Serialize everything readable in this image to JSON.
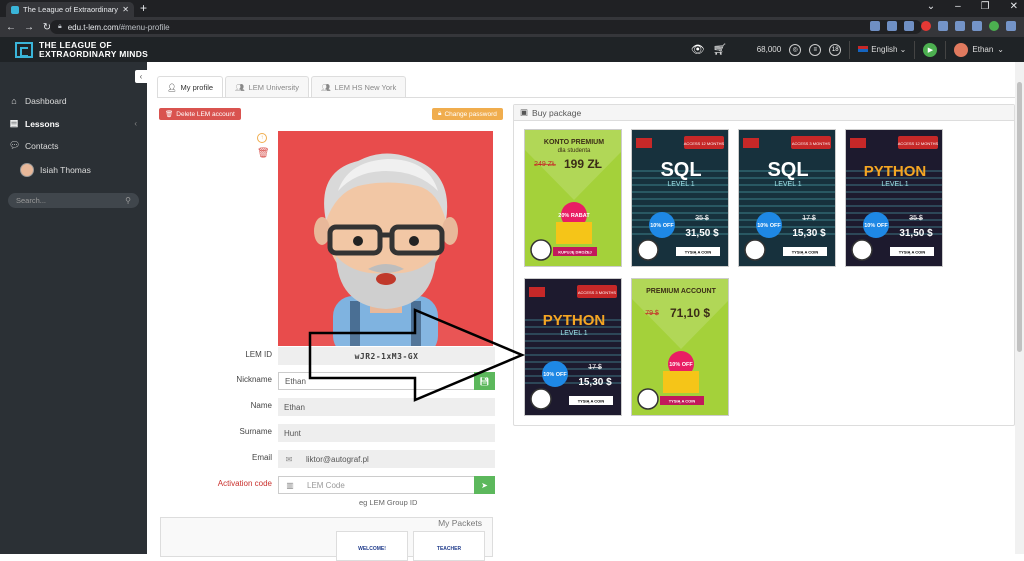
{
  "browser": {
    "tab_title": "The League of Extraordinary Mi",
    "url_host": "edu.t-lem.com",
    "url_path": "/#menu-profile"
  },
  "app": {
    "logo_line1": "THE LEAGUE OF",
    "logo_line2": "EXTRAORDINARY MINDS",
    "coins": "68,000",
    "badge3": "18",
    "language": "English",
    "user_name": "Ethan"
  },
  "sidebar": {
    "items": [
      {
        "label": "Dashboard"
      },
      {
        "label": "Lessons"
      },
      {
        "label": "Contacts"
      },
      {
        "label": "Isiah Thomas"
      }
    ],
    "search_placeholder": "Search..."
  },
  "tabs": [
    {
      "label": "My profile"
    },
    {
      "label": "LEM University"
    },
    {
      "label": "LEM HS New York"
    }
  ],
  "actions": {
    "delete_label": "Delete LEM account",
    "change_password_label": "Change password"
  },
  "profile": {
    "lem_id_label": "LEM ID",
    "lem_id_value": "wJR2-1xM3-GX",
    "nickname_label": "Nickname",
    "nickname_value": "Ethan",
    "name_label": "Name",
    "name_value": "Ethan",
    "surname_label": "Surname",
    "surname_value": "Hunt",
    "email_label": "Email",
    "email_value": "liktor@autograf.pl",
    "activation_label": "Activation code",
    "activation_placeholder": "LEM Code",
    "hint": "eg LEM Group ID"
  },
  "packets": {
    "title": "My Packets",
    "cards": [
      "WELCOME!",
      "TEACHER"
    ]
  },
  "buy_package": {
    "title": "Buy package",
    "cards": [
      {
        "bg": "#a4d13a",
        "title": "KONTO PREMIUM",
        "sub": "dla studenta",
        "old_price": "249 ZŁ",
        "price": "199 ZŁ",
        "badge": "20% RABAT",
        "button": "KUPUJĘ DROŻEJ"
      },
      {
        "bg": "#17313d",
        "title": "SQL",
        "sub": "LEVEL 1",
        "old_price": "35 $",
        "price": "31,50 $",
        "badge": "10% OFF",
        "button": "TYSIĄ A COIN",
        "tag": "ACCESS 12 MONTHS"
      },
      {
        "bg": "#17313d",
        "title": "SQL",
        "sub": "LEVEL 1",
        "old_price": "17 $",
        "price": "15,30 $",
        "badge": "10% OFF",
        "button": "TYSIĄ A COIN",
        "tag": "ACCESS 3 MONTHS"
      },
      {
        "bg": "#1d1a2e",
        "title": "PYTHON",
        "sub": "LEVEL 1",
        "old_price": "35 $",
        "price": "31,50 $",
        "badge": "10% OFF",
        "button": "TYSIĄ A COIN",
        "tag": "ACCESS 12 MONTHS"
      },
      {
        "bg": "#1d1a2e",
        "title": "PYTHON",
        "sub": "LEVEL 1",
        "old_price": "17 $",
        "price": "15,30 $",
        "badge": "10% OFF",
        "button": "TYSIĄ A COIN",
        "tag": "ACCESS 3 MONTHS"
      },
      {
        "bg": "#a4d13a",
        "title": "PREMIUM ACCOUNT",
        "sub": "",
        "old_price": "79 $",
        "price": "71,10 $",
        "badge": "10% OFF",
        "button": "TYSIĄ A COIN"
      }
    ]
  },
  "colors": {
    "sidebar_bg": "#2b3035",
    "appbar_bg": "#1f2326",
    "accent": "#3ab5d9",
    "danger": "#d9534f",
    "warning": "#f0ad4e",
    "success": "#5cb85c",
    "avatar_bg": "#e84c4c"
  }
}
